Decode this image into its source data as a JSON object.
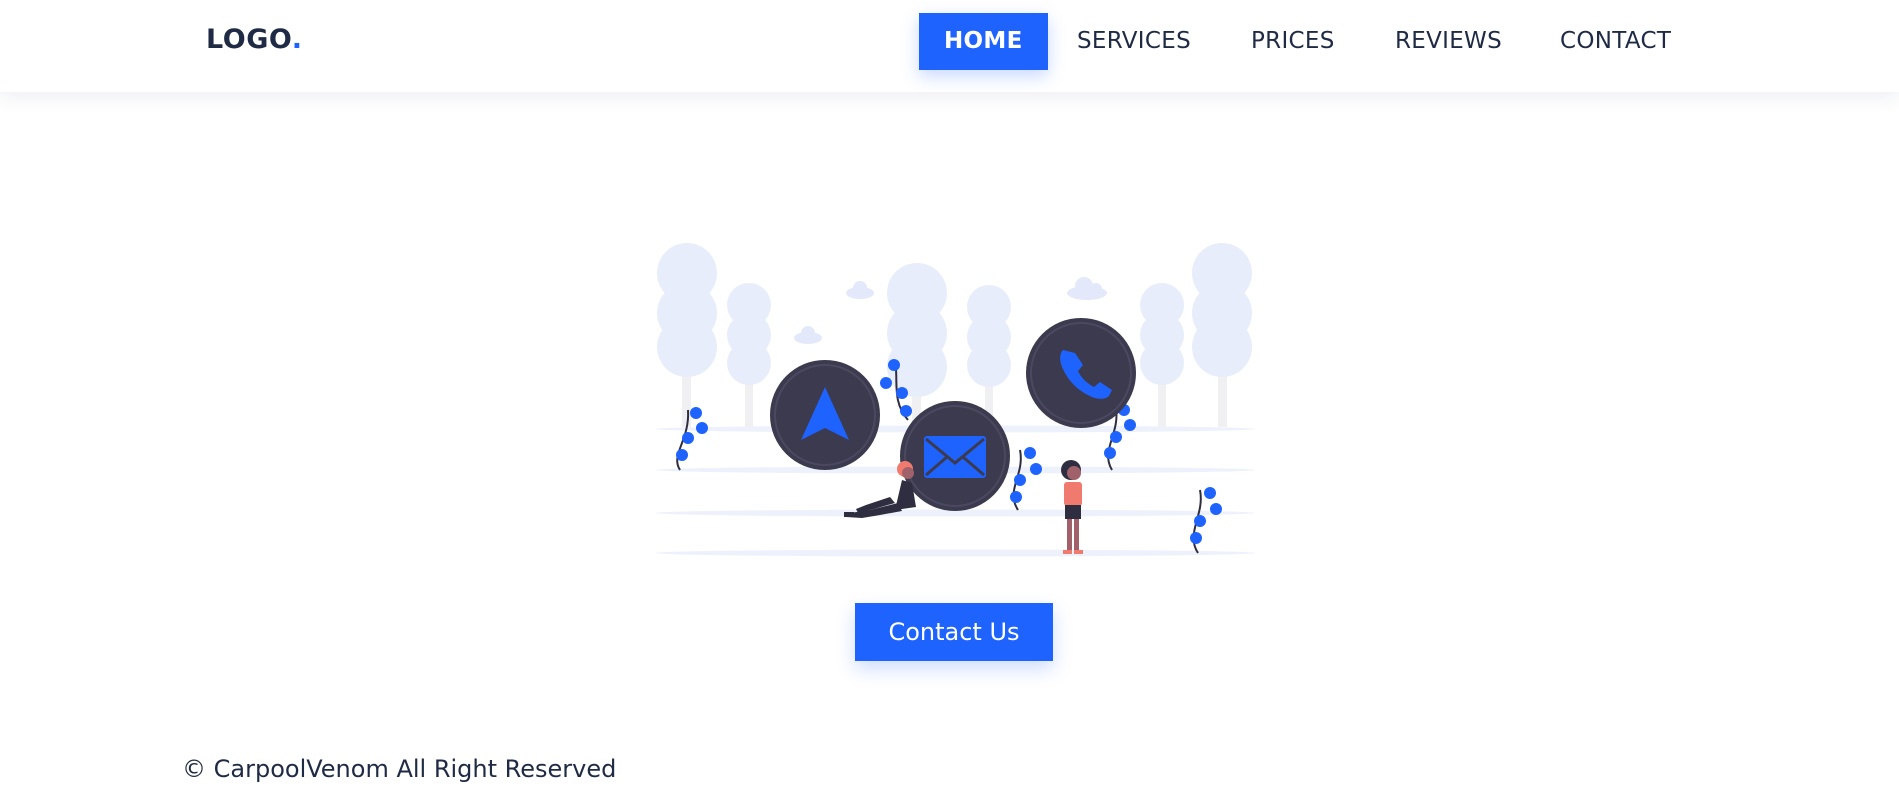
{
  "header": {
    "logo_text": "LOGO",
    "logo_dot": ".",
    "nav": [
      {
        "label": "HOME",
        "active": true
      },
      {
        "label": "SERVICES",
        "active": false
      },
      {
        "label": "PRICES",
        "active": false
      },
      {
        "label": "REVIEWS",
        "active": false
      },
      {
        "label": "CONTACT",
        "active": false
      }
    ]
  },
  "hero": {
    "illustration_icons": [
      "navigation-arrow-icon",
      "mail-icon",
      "phone-icon"
    ],
    "cta_label": "Contact Us"
  },
  "footer": {
    "copyright": "© CarpoolVenom All Right Reserved"
  },
  "colors": {
    "accent": "#1f63ff",
    "text": "#1f2a44",
    "circle": "#3b3a4e",
    "tree": "#e8edfb"
  }
}
